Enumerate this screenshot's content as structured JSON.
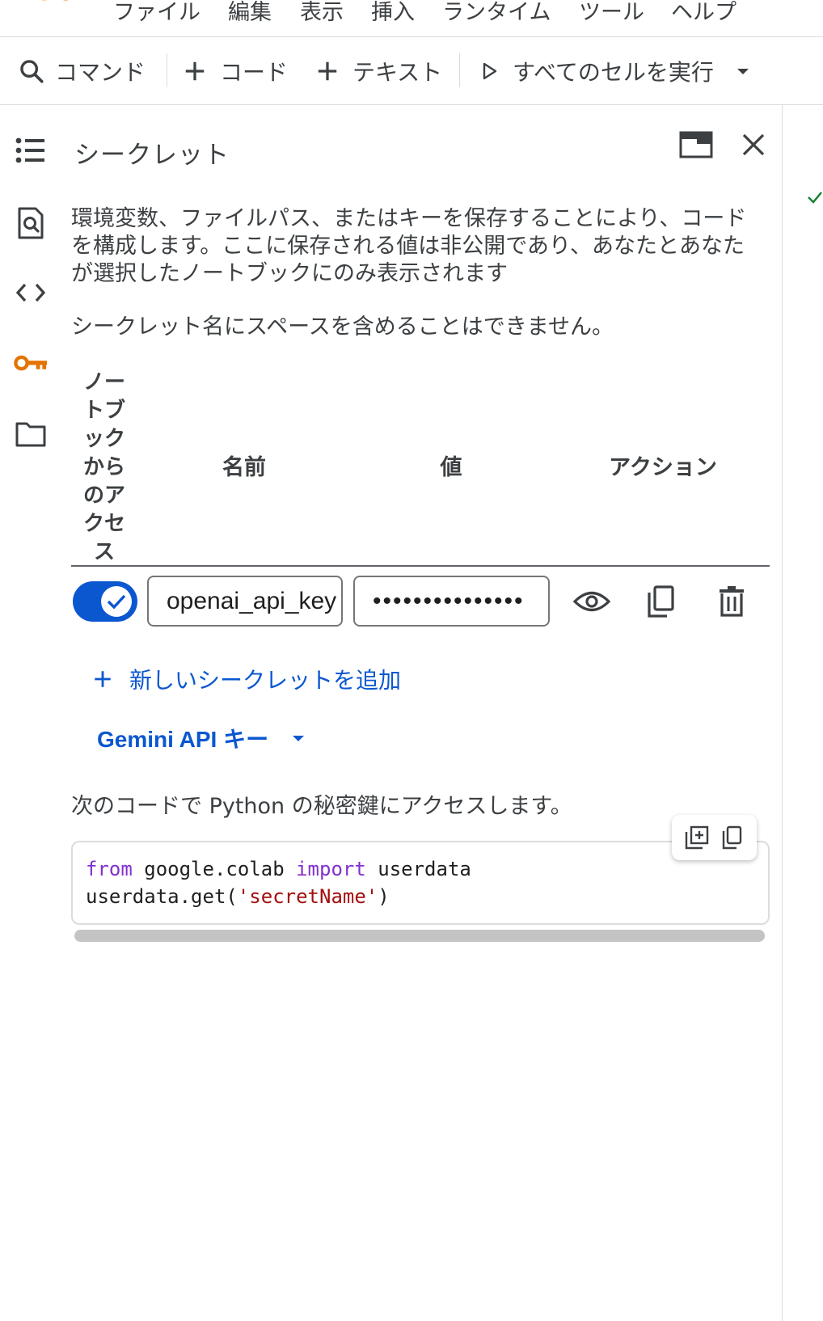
{
  "menubar": {
    "items": [
      "ファイル",
      "編集",
      "表示",
      "挿入",
      "ランタイム",
      "ツール",
      "ヘルプ"
    ]
  },
  "toolbar": {
    "command_label": "コマンド",
    "code_label": "コード",
    "text_label": "テキスト",
    "run_all_label": "すべてのセルを実行"
  },
  "panel": {
    "title": "シークレット",
    "description": "環境変数、ファイルパス、またはキーを保存することにより、コードを構成します。ここに保存される値は非公開であり、あなたとあなたが選択したノートブックにのみ表示されます",
    "note": "シークレット名にスペースを含めることはできません。",
    "table": {
      "headers": {
        "access": "ノートブックからのアクセス",
        "name": "名前",
        "value": "値",
        "actions": "アクション"
      },
      "rows": [
        {
          "access_enabled": true,
          "name": "openai_api_key",
          "value": "•••••••••••••••"
        }
      ]
    },
    "add_secret_label": "新しいシークレットを追加",
    "gemini_label": "Gemini API キー",
    "access_note": "次のコードで Python の秘密鍵にアクセスします。",
    "code": {
      "line1_kw1": "from",
      "line1_mid": " google.colab ",
      "line1_kw2": "import",
      "line1_end": " userdata",
      "line2_pre": "userdata.get(",
      "line2_str": "'secretName'",
      "line2_post": ")"
    }
  },
  "colors": {
    "accent": "#0b57d0",
    "key_icon": "#e37400",
    "keyword": "#8430ce",
    "string": "#a50e0e",
    "check": "#188038"
  }
}
